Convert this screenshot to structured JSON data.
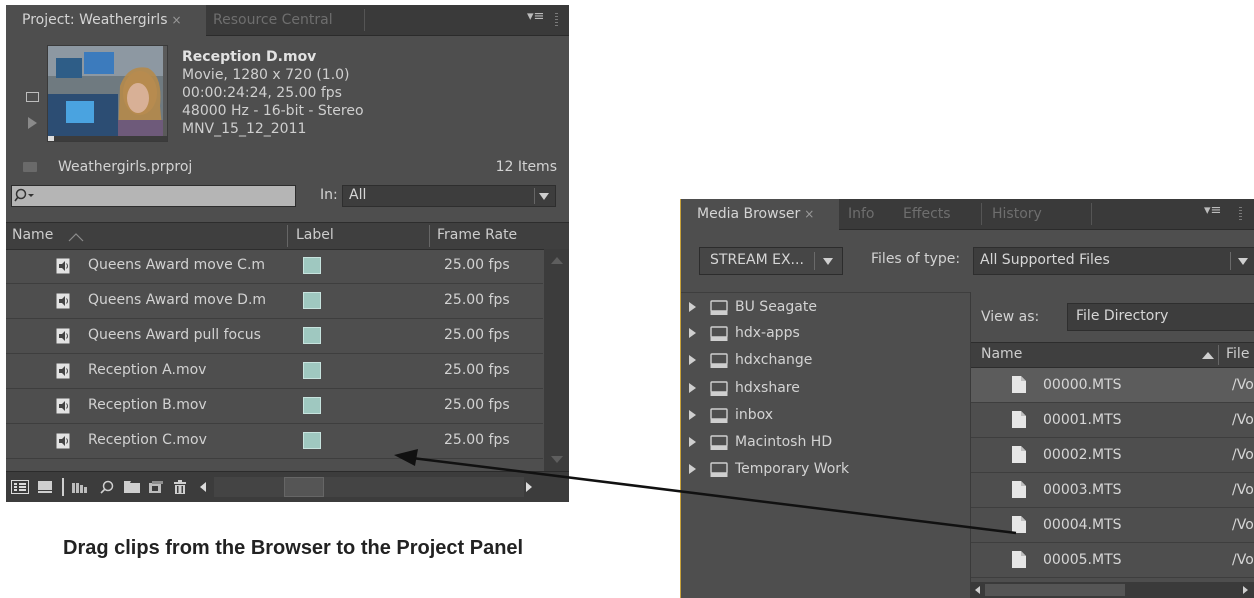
{
  "project_panel": {
    "tabs": [
      {
        "label": "Project: Weathergirls",
        "close": "×"
      },
      {
        "label": "Resource Central"
      }
    ],
    "menu_icon": "≡",
    "clip_info": {
      "name": "Reception D.mov",
      "line1": "Movie, 1280 x 720 (1.0)",
      "line2": "00:00:24:24, 25.00 fps",
      "line3": "48000 Hz - 16-bit - Stereo",
      "line4": "MNV_15_12_2011"
    },
    "project_file": "Weathergirls.prproj",
    "item_count": "12 Items",
    "search": {
      "placeholder": "",
      "icon": "search-icon"
    },
    "in_label": "In:",
    "in_value": "All",
    "columns": {
      "name": "Name",
      "label": "Label",
      "frame_rate": "Frame Rate"
    },
    "rows": [
      {
        "name": "Queens Award move C.m",
        "fps": "25.00 fps"
      },
      {
        "name": "Queens Award move D.m",
        "fps": "25.00 fps"
      },
      {
        "name": "Queens Award pull focus",
        "fps": "25.00 fps"
      },
      {
        "name": "Reception A.mov",
        "fps": "25.00 fps"
      },
      {
        "name": "Reception B.mov",
        "fps": "25.00 fps"
      },
      {
        "name": "Reception C.mov",
        "fps": "25.00 fps"
      }
    ],
    "label_color": "#9fc8c0"
  },
  "media_browser": {
    "tabs": [
      {
        "label": "Media Browser",
        "close": "×"
      },
      {
        "label": "Info"
      },
      {
        "label": "Effects"
      },
      {
        "label": "History"
      }
    ],
    "menu_icon": "≡",
    "location_value": "STREAM EX...",
    "files_of_type_label": "Files of type:",
    "files_of_type_value": "All Supported Files",
    "drives": [
      "BU Seagate",
      "hdx-apps",
      "hdxchange",
      "hdxshare",
      "inbox",
      "Macintosh HD",
      "Temporary Work"
    ],
    "view_as_label": "View as:",
    "view_as_value": "File Directory",
    "columns": {
      "name": "Name",
      "file": "File"
    },
    "files": [
      {
        "name": "00000.MTS",
        "path": "/Vo"
      },
      {
        "name": "00001.MTS",
        "path": "/Vo"
      },
      {
        "name": "00002.MTS",
        "path": "/Vo"
      },
      {
        "name": "00003.MTS",
        "path": "/Vo"
      },
      {
        "name": "00004.MTS",
        "path": "/Vo"
      },
      {
        "name": "00005.MTS",
        "path": "/Vo"
      }
    ],
    "accent_border": "#c8a23c"
  },
  "caption": "Drag clips from the Browser to the Project Panel"
}
